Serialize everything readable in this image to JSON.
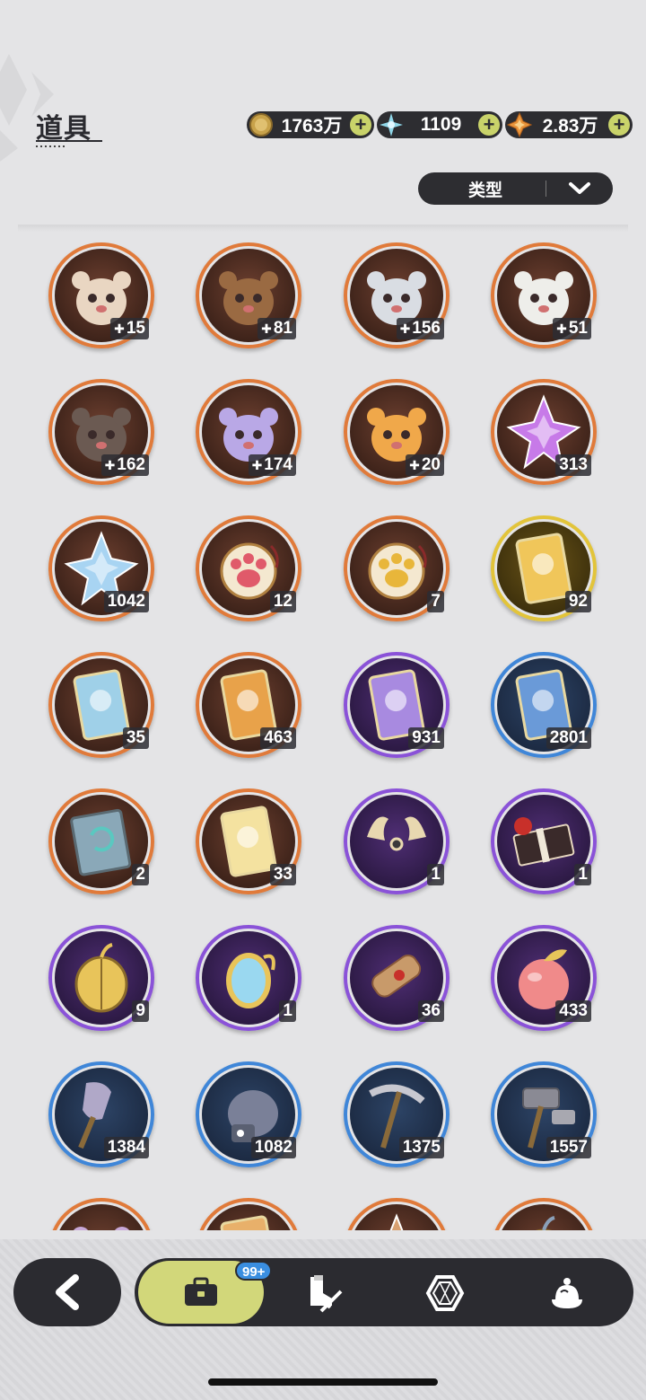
{
  "header": {
    "title": "道具"
  },
  "currencies": [
    {
      "icon": "gold-coin-icon",
      "value": "1763万",
      "color": "#c8a24a"
    },
    {
      "icon": "crystal-flower-icon",
      "value": "1109",
      "color": "#8fd6e8"
    },
    {
      "icon": "orange-star-gem-icon",
      "value": "2.83万",
      "color": "#e8933a"
    }
  ],
  "filter": {
    "label": "类型"
  },
  "items": [
    {
      "name": "cat-plush-fragment",
      "count": "15",
      "fragment": true,
      "rarity": "orange",
      "art": "plush",
      "hue": "#e9d6c2"
    },
    {
      "name": "bear-plush-fragment",
      "count": "81",
      "fragment": true,
      "rarity": "orange",
      "art": "plush",
      "hue": "#9a6a42"
    },
    {
      "name": "knight-plush-fragment",
      "count": "156",
      "fragment": true,
      "rarity": "orange",
      "art": "plush",
      "hue": "#d9dde3"
    },
    {
      "name": "white-cat-plush-fragment",
      "count": "51",
      "fragment": true,
      "rarity": "orange",
      "art": "plush",
      "hue": "#eeeeea"
    },
    {
      "name": "dark-bear-plush-fragment",
      "count": "162",
      "fragment": true,
      "rarity": "orange",
      "art": "plush",
      "hue": "#6b5a52"
    },
    {
      "name": "lilac-cat-plush-fragment",
      "count": "174",
      "fragment": true,
      "rarity": "orange",
      "art": "plush",
      "hue": "#b9a8e6"
    },
    {
      "name": "tiger-plush-fragment",
      "count": "20",
      "fragment": true,
      "rarity": "orange",
      "art": "plush",
      "hue": "#f0a84a"
    },
    {
      "name": "purple-star-crystal",
      "count": "313",
      "fragment": false,
      "rarity": "orange",
      "art": "crystal",
      "hue": "#c77ae8"
    },
    {
      "name": "blue-star-crystal",
      "count": "1042",
      "fragment": false,
      "rarity": "orange",
      "art": "crystal",
      "hue": "#a8d4f2"
    },
    {
      "name": "red-paw-pendant",
      "count": "12",
      "fragment": false,
      "rarity": "orange",
      "art": "paw",
      "hue": "#e05a6a"
    },
    {
      "name": "gold-paw-pendant",
      "count": "7",
      "fragment": false,
      "rarity": "orange",
      "art": "paw",
      "hue": "#e8b63a"
    },
    {
      "name": "golden-character-card",
      "count": "92",
      "fragment": false,
      "rarity": "gold",
      "art": "card",
      "hue": "#f0c65a"
    },
    {
      "name": "rainbow-character-card",
      "count": "35",
      "fragment": false,
      "rarity": "orange",
      "art": "card",
      "hue": "#9fd0e8"
    },
    {
      "name": "orange-character-card",
      "count": "463",
      "fragment": false,
      "rarity": "orange",
      "art": "card",
      "hue": "#e8a24a"
    },
    {
      "name": "purple-character-card",
      "count": "931",
      "fragment": false,
      "rarity": "purple",
      "art": "card",
      "hue": "#a88ae0"
    },
    {
      "name": "blue-character-card",
      "count": "2801",
      "fragment": false,
      "rarity": "blue",
      "art": "card",
      "hue": "#6a9ad8"
    },
    {
      "name": "recycle-book",
      "count": "2",
      "fragment": false,
      "rarity": "orange",
      "art": "book",
      "hue": "#8aa8b8"
    },
    {
      "name": "clover-card",
      "count": "33",
      "fragment": false,
      "rarity": "orange",
      "art": "card",
      "hue": "#f4e2a0"
    },
    {
      "name": "golden-horns",
      "count": "1",
      "fragment": false,
      "rarity": "purple",
      "art": "horns",
      "hue": "#e8d8b0"
    },
    {
      "name": "gift-box",
      "count": "1",
      "fragment": false,
      "rarity": "purple",
      "art": "gift",
      "hue": "#3a2a2a"
    },
    {
      "name": "golden-beetle",
      "count": "9",
      "fragment": false,
      "rarity": "purple",
      "art": "beetle",
      "hue": "#e8c45a"
    },
    {
      "name": "magic-mirror",
      "count": "1",
      "fragment": false,
      "rarity": "purple",
      "art": "mirror",
      "hue": "#9ad8f0"
    },
    {
      "name": "scroll",
      "count": "36",
      "fragment": false,
      "rarity": "purple",
      "art": "scroll",
      "hue": "#c89a6a"
    },
    {
      "name": "peach",
      "count": "433",
      "fragment": false,
      "rarity": "purple",
      "art": "peach",
      "hue": "#f08a8a"
    },
    {
      "name": "shovel",
      "count": "1384",
      "fragment": false,
      "rarity": "blue",
      "art": "shovel",
      "hue": "#b0a8c8"
    },
    {
      "name": "boxing-glove",
      "count": "1082",
      "fragment": false,
      "rarity": "blue",
      "art": "glove",
      "hue": "#7a8098"
    },
    {
      "name": "pickaxe",
      "count": "1375",
      "fragment": false,
      "rarity": "blue",
      "art": "pickaxe",
      "hue": "#6a6a72"
    },
    {
      "name": "hammer",
      "count": "1557",
      "fragment": false,
      "rarity": "blue",
      "art": "hammer",
      "hue": "#8a8a94"
    },
    {
      "name": "partial-item-1",
      "count": "",
      "fragment": false,
      "rarity": "orange",
      "art": "plush",
      "hue": "#c8a8d8"
    },
    {
      "name": "partial-item-2",
      "count": "",
      "fragment": false,
      "rarity": "orange",
      "art": "card",
      "hue": "#e8b06a"
    },
    {
      "name": "partial-item-3",
      "count": "",
      "fragment": false,
      "rarity": "orange",
      "art": "crystal",
      "hue": "#d8a070"
    },
    {
      "name": "partial-item-4",
      "count": "",
      "fragment": false,
      "rarity": "orange",
      "art": "beetle",
      "hue": "#8aa0b8"
    }
  ],
  "nav": {
    "badge": "99+",
    "tabs": [
      {
        "name": "tab-bag",
        "icon": "briefcase-icon",
        "active": true
      },
      {
        "name": "tab-equipment",
        "icon": "boot-sword-icon",
        "active": false
      },
      {
        "name": "tab-gems",
        "icon": "hexagon-gem-icon",
        "active": false
      },
      {
        "name": "tab-food",
        "icon": "pudding-icon",
        "active": false
      }
    ]
  }
}
